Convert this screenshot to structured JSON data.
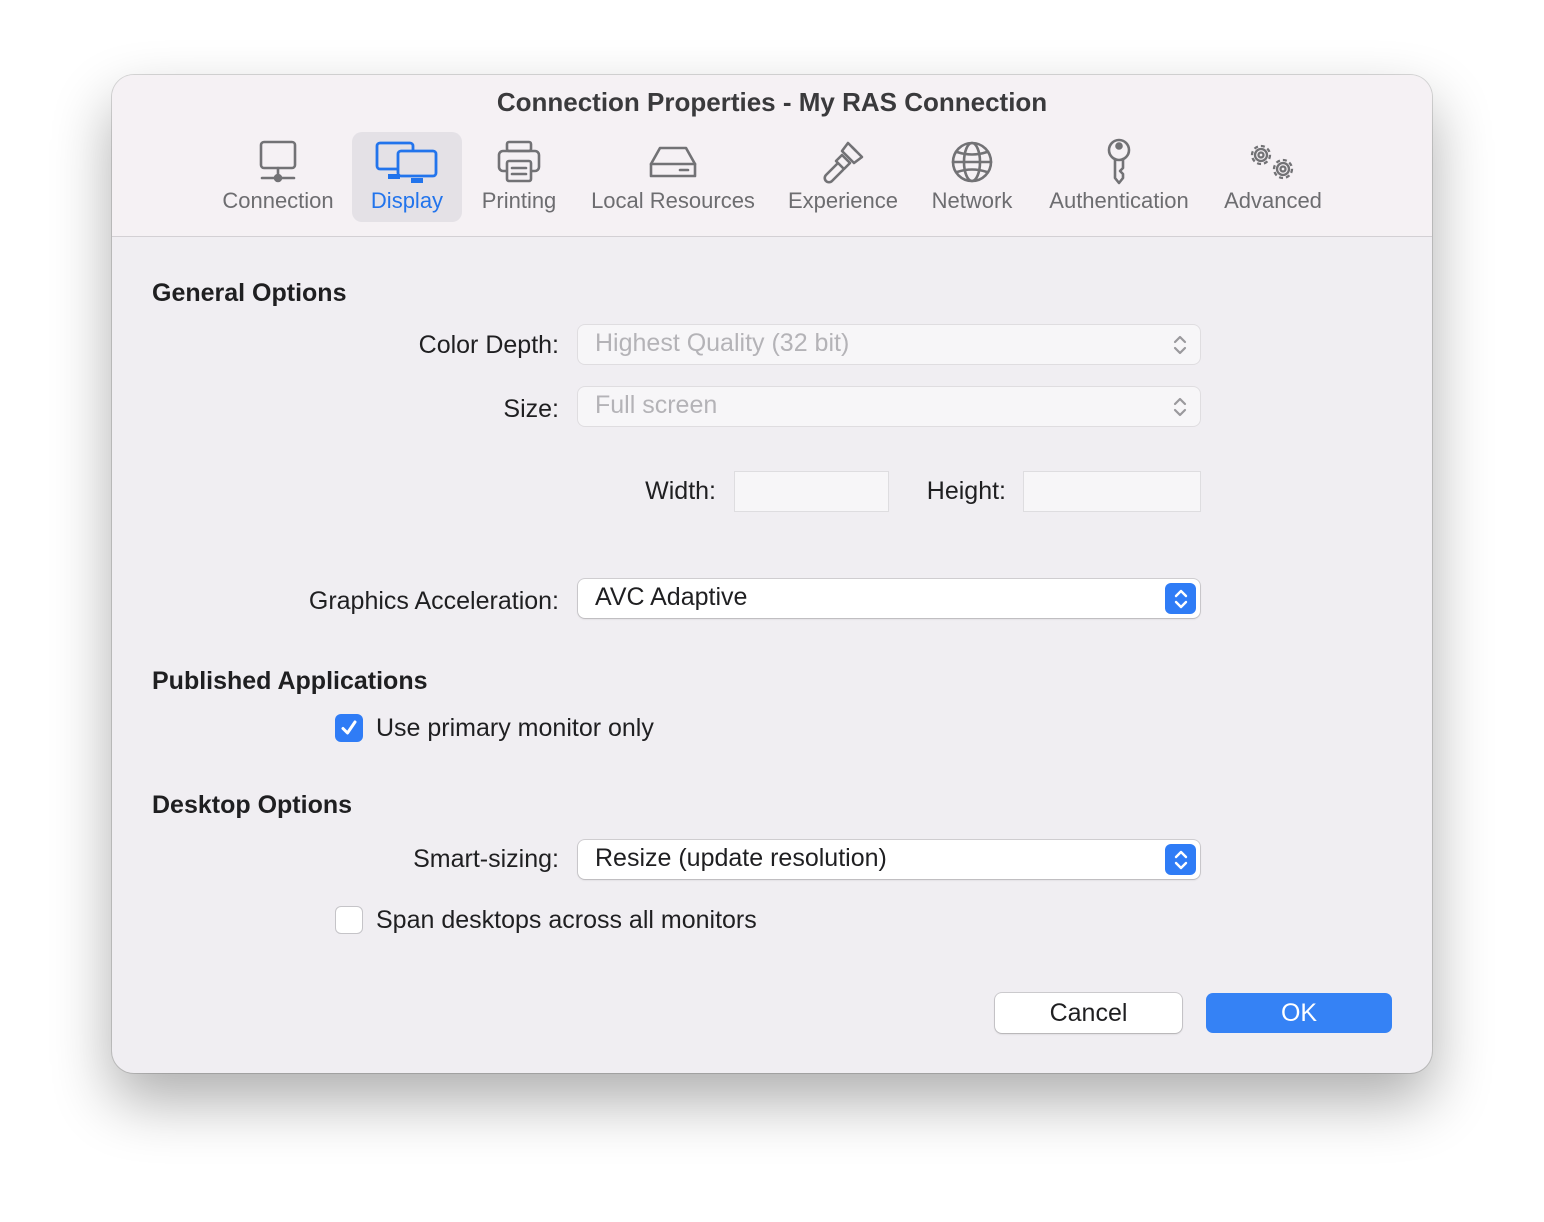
{
  "window": {
    "title": "Connection Properties - My RAS Connection"
  },
  "tabs": [
    {
      "label": "Connection",
      "icon": "monitor-icon"
    },
    {
      "label": "Display",
      "icon": "displays-icon",
      "active": true
    },
    {
      "label": "Printing",
      "icon": "printer-icon"
    },
    {
      "label": "Local Resources",
      "icon": "drive-icon"
    },
    {
      "label": "Experience",
      "icon": "paintbrush-icon"
    },
    {
      "label": "Network",
      "icon": "globe-icon"
    },
    {
      "label": "Authentication",
      "icon": "key-icon"
    },
    {
      "label": "Advanced",
      "icon": "gears-icon"
    }
  ],
  "general": {
    "heading": "General Options",
    "color_depth": {
      "label": "Color Depth:",
      "value": "Highest Quality (32 bit)",
      "enabled": false
    },
    "size": {
      "label": "Size:",
      "value": "Full screen",
      "enabled": false
    },
    "width": {
      "label": "Width:",
      "value": ""
    },
    "height": {
      "label": "Height:",
      "value": ""
    },
    "graphics": {
      "label": "Graphics Acceleration:",
      "value": "AVC Adaptive"
    }
  },
  "published": {
    "heading": "Published Applications",
    "primary_monitor": {
      "label": "Use primary monitor only",
      "checked": true
    }
  },
  "desktop": {
    "heading": "Desktop Options",
    "smart_sizing": {
      "label": "Smart-sizing:",
      "value": "Resize (update resolution)"
    },
    "span": {
      "label": "Span desktops across all monitors",
      "checked": false
    }
  },
  "buttons": {
    "cancel": "Cancel",
    "ok": "OK"
  },
  "colors": {
    "accent": "#2f7cf6",
    "active_tab_text": "#2274ec",
    "window_bg": "#f0eef2"
  }
}
